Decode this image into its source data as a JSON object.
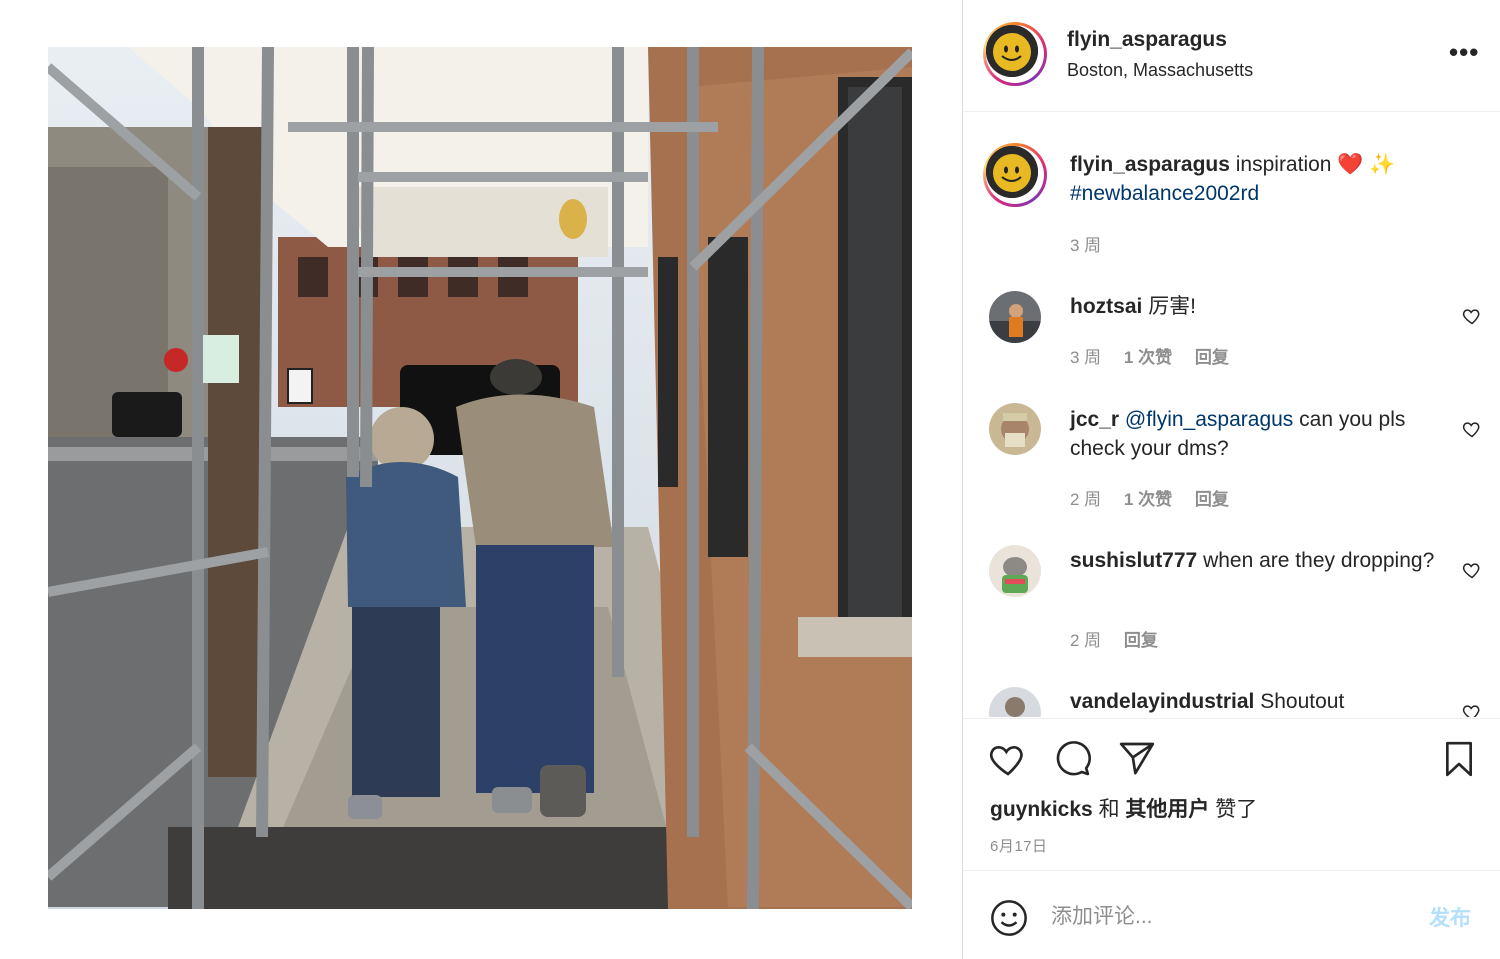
{
  "post": {
    "username": "flyin_asparagus",
    "location": "Boston, Massachusetts",
    "more_label": "•••"
  },
  "caption": {
    "username": "flyin_asparagus",
    "text": "inspiration",
    "emoji": "❤️ ✨",
    "hashtag": "#newbalance2002rd",
    "time": "3 周"
  },
  "comments": [
    {
      "username": "hoztsai",
      "text": "厉害!",
      "time": "3 周",
      "likes": "1 次赞",
      "reply": "回复"
    },
    {
      "username": "jcc_r",
      "mention": "@flyin_asparagus",
      "text": "can you pls check your dms?",
      "time": "2 周",
      "likes": "1 次赞",
      "reply": "回复"
    },
    {
      "username": "sushislut777",
      "text": "when are they dropping?",
      "time": "2 周",
      "reply": "回复"
    },
    {
      "username": "vandelayindustrial",
      "text": "Shoutout"
    }
  ],
  "likes": {
    "user": "guynkicks",
    "connector": "和",
    "others": "其他用户",
    "suffix": "赞了"
  },
  "date": "6月17日",
  "comment_box": {
    "placeholder": "添加评论...",
    "post_label": "发布"
  },
  "icons": [
    "heart-icon",
    "comment-icon",
    "share-icon",
    "bookmark-icon",
    "emoji-icon",
    "more-icon"
  ],
  "colors": {
    "link": "#00376b",
    "muted": "#8e8e8e",
    "post_button_disabled": "#b2dffc",
    "heart_emoji": "#e0245e"
  }
}
